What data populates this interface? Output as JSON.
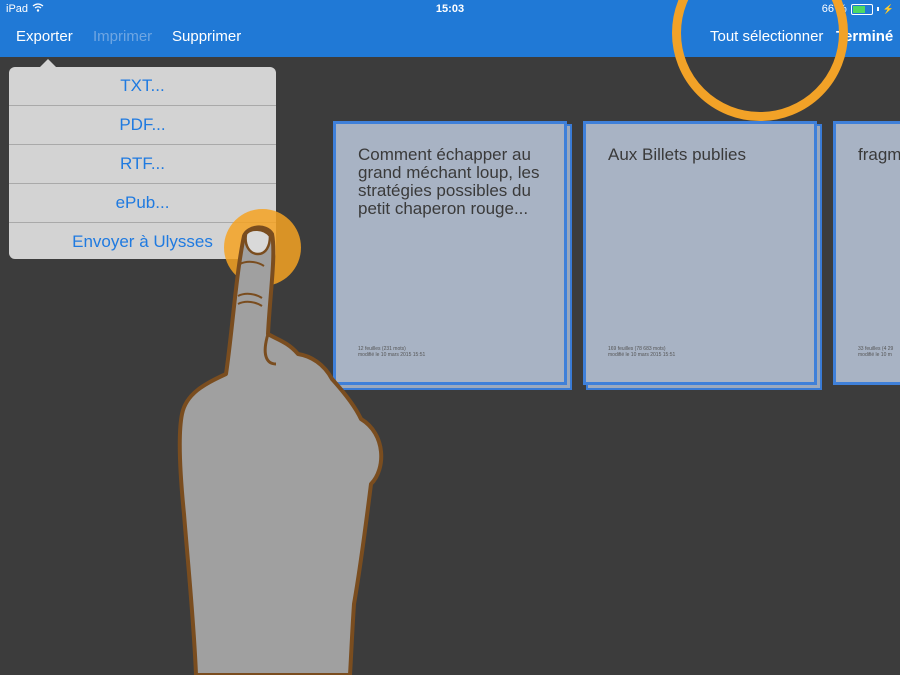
{
  "status": {
    "carrier": "iPad",
    "time": "15:03",
    "battery_text": "66 %",
    "battery_level": 0.66
  },
  "toolbar": {
    "export_label": "Exporter",
    "print_label": "Imprimer",
    "delete_label": "Supprimer",
    "select_all_label": "Tout sélectionner",
    "done_label": "Terminé"
  },
  "export_menu": {
    "items": [
      {
        "label": "TXT..."
      },
      {
        "label": "PDF..."
      },
      {
        "label": "RTF..."
      },
      {
        "label": "ePub..."
      },
      {
        "label": "Envoyer à Ulysses"
      }
    ]
  },
  "documents": [
    {
      "title": "Comment échapper au grand méchant loup, les stratégies possibles du petit chaperon rouge...",
      "meta_line1": "12 feuilles (231 mots)",
      "meta_line2": "modifié le 10 mars 2015 15:51"
    },
    {
      "title": "Aux Billets publies",
      "meta_line1": "169 feuilles (78 683 mots)",
      "meta_line2": "modifié le 10 mars 2015 15:51"
    },
    {
      "title": "fragm",
      "meta_line1": "33 feuilles (4 29",
      "meta_line2": "modifié le 10 m"
    }
  ],
  "colors": {
    "toolbar_blue": "#2079d6",
    "menu_text_blue": "#1f7ae0",
    "highlight_orange": "#f2a227",
    "background": "#3c3c3c"
  }
}
